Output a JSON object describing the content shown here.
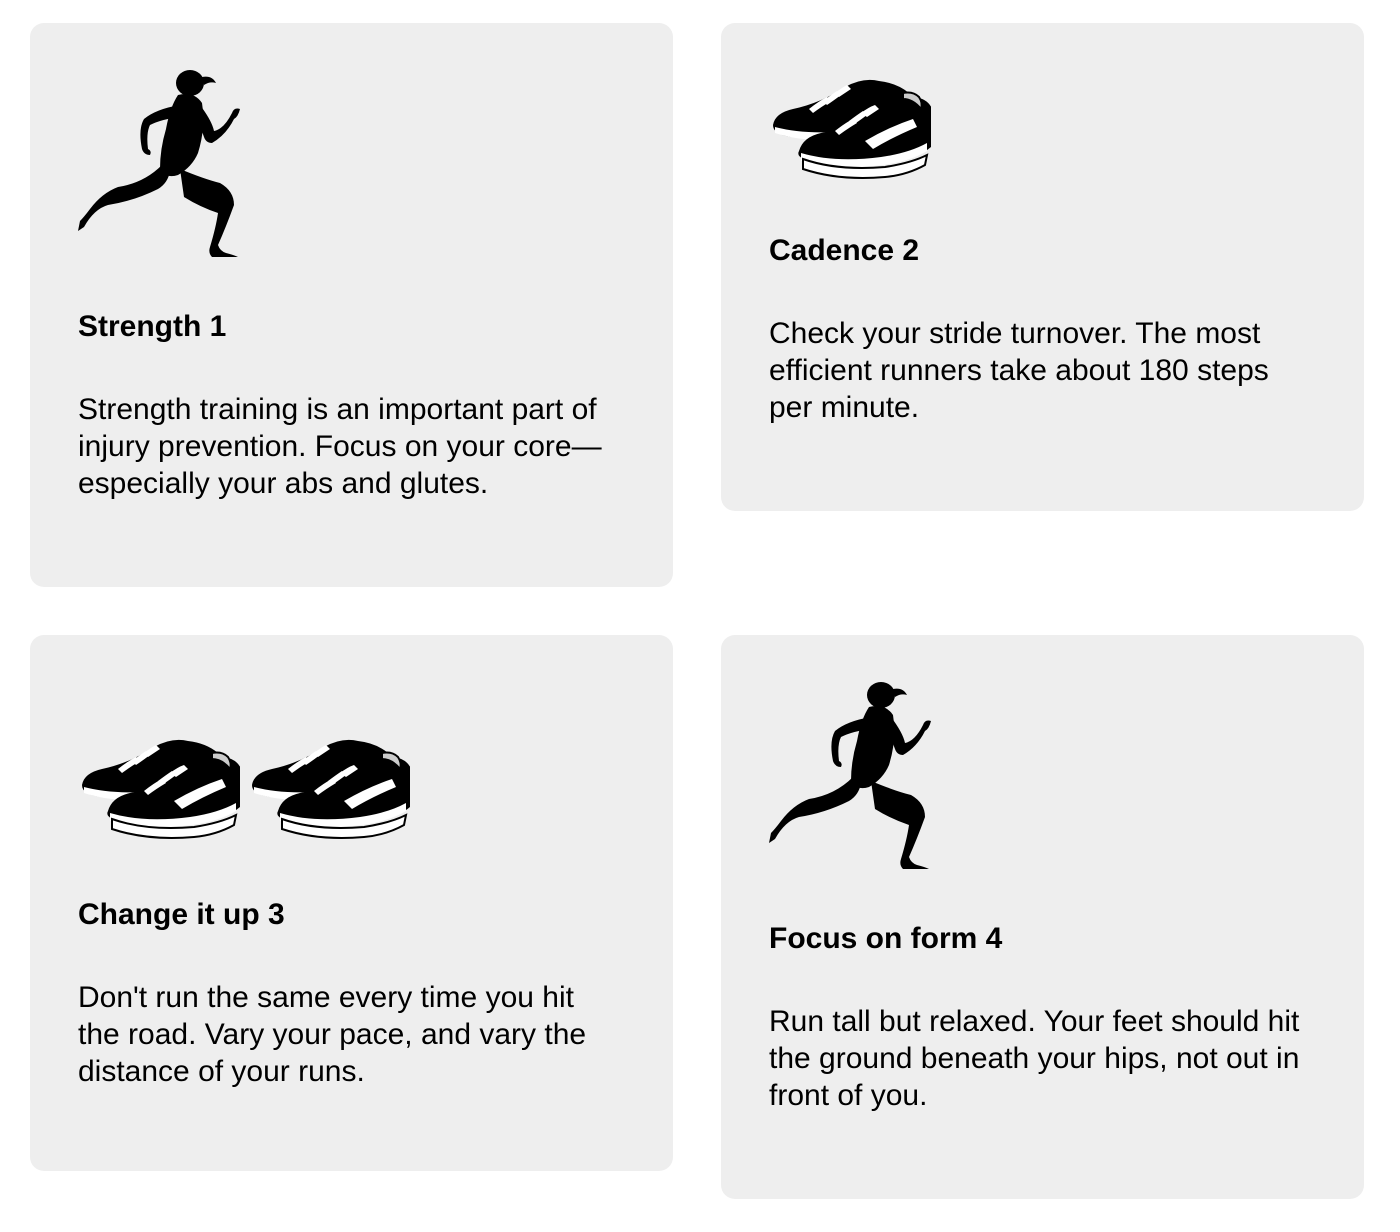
{
  "cards": [
    {
      "title": "Strength 1",
      "text": "Strength training is an important part of injury prevention. Focus on your core— especially your abs and glutes.",
      "icons": [
        "runner-icon"
      ]
    },
    {
      "title": "Cadence 2",
      "text": "Check your stride turnover. The most efficient runners take about 180 steps per minute.",
      "icons": [
        "shoes-icon"
      ]
    },
    {
      "title": "Change it up 3",
      "text": "Don't run the same every time you hit the road. Vary your pace, and vary the distance of your runs.",
      "icons": [
        "shoes-icon",
        "shoes-icon"
      ]
    },
    {
      "title": "Focus on form 4",
      "text": "Run tall but relaxed. Your feet should hit the ground beneath your hips, not out in front of you.",
      "icons": [
        "runner-icon"
      ]
    }
  ],
  "colors": {
    "card_background": "#eeeeee",
    "page_background": "#ffffff",
    "text": "#000000"
  }
}
